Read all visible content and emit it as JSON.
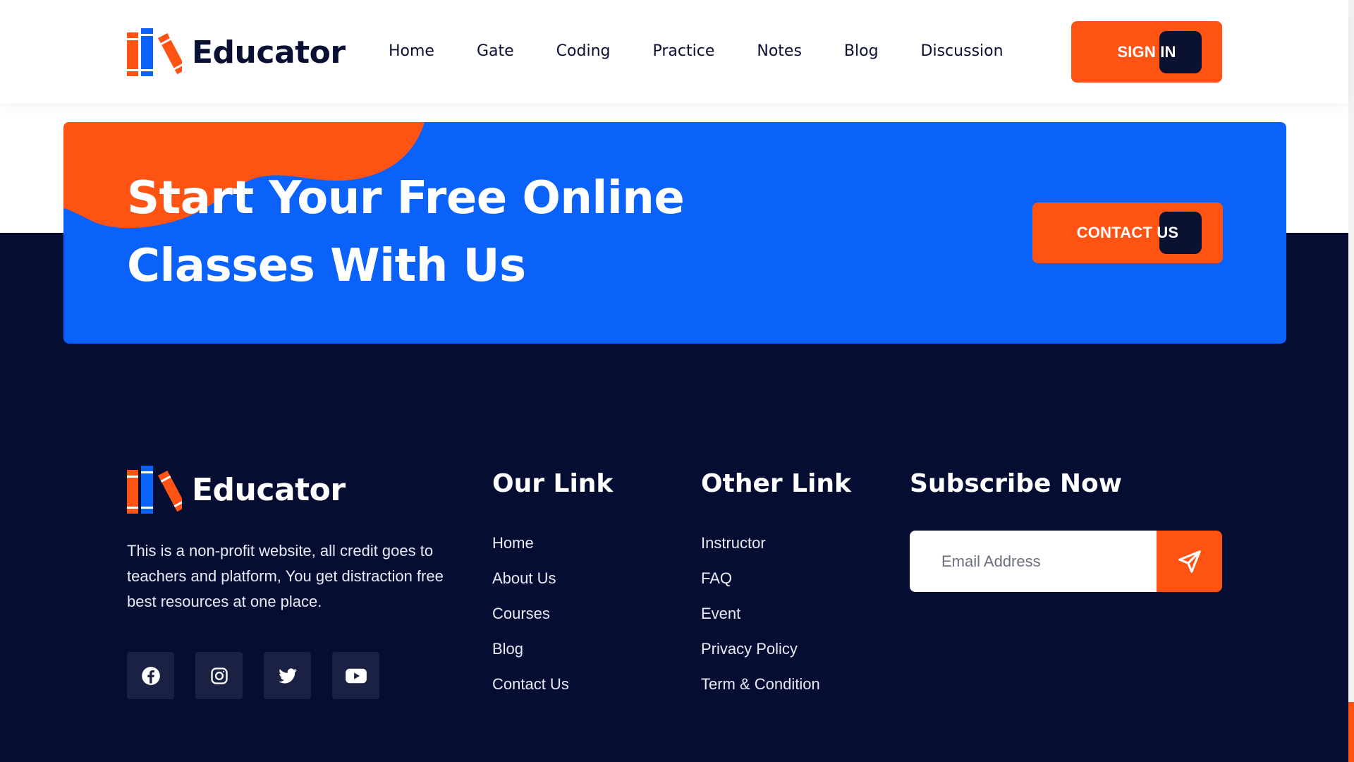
{
  "brand": {
    "name": "Educator",
    "accent": "#ff5314",
    "primary": "#0a62fa",
    "dark": "#060d33"
  },
  "header": {
    "nav": [
      "Home",
      "Gate",
      "Coding",
      "Practice",
      "Notes",
      "Blog",
      "Discussion"
    ],
    "signin_label": "SIGN IN"
  },
  "cta": {
    "line1": "Start Your Free Online",
    "line2": "Classes With Us",
    "button_label": "CONTACT US"
  },
  "footer": {
    "about": "This is a non-profit website, all credit goes to teachers and platform, You get distraction free best resources at one place.",
    "socials": [
      "facebook-icon",
      "instagram-icon",
      "twitter-icon",
      "youtube-icon"
    ],
    "our_link": {
      "title": "Our Link",
      "items": [
        "Home",
        "About Us",
        "Courses",
        "Blog",
        "Contact Us"
      ]
    },
    "other_link": {
      "title": "Other Link",
      "items": [
        "Instructor",
        "FAQ",
        "Event",
        "Privacy Policy",
        "Term & Condition"
      ]
    },
    "subscribe": {
      "title": "Subscribe Now",
      "placeholder": "Email Address",
      "send_icon": "send-icon"
    }
  }
}
